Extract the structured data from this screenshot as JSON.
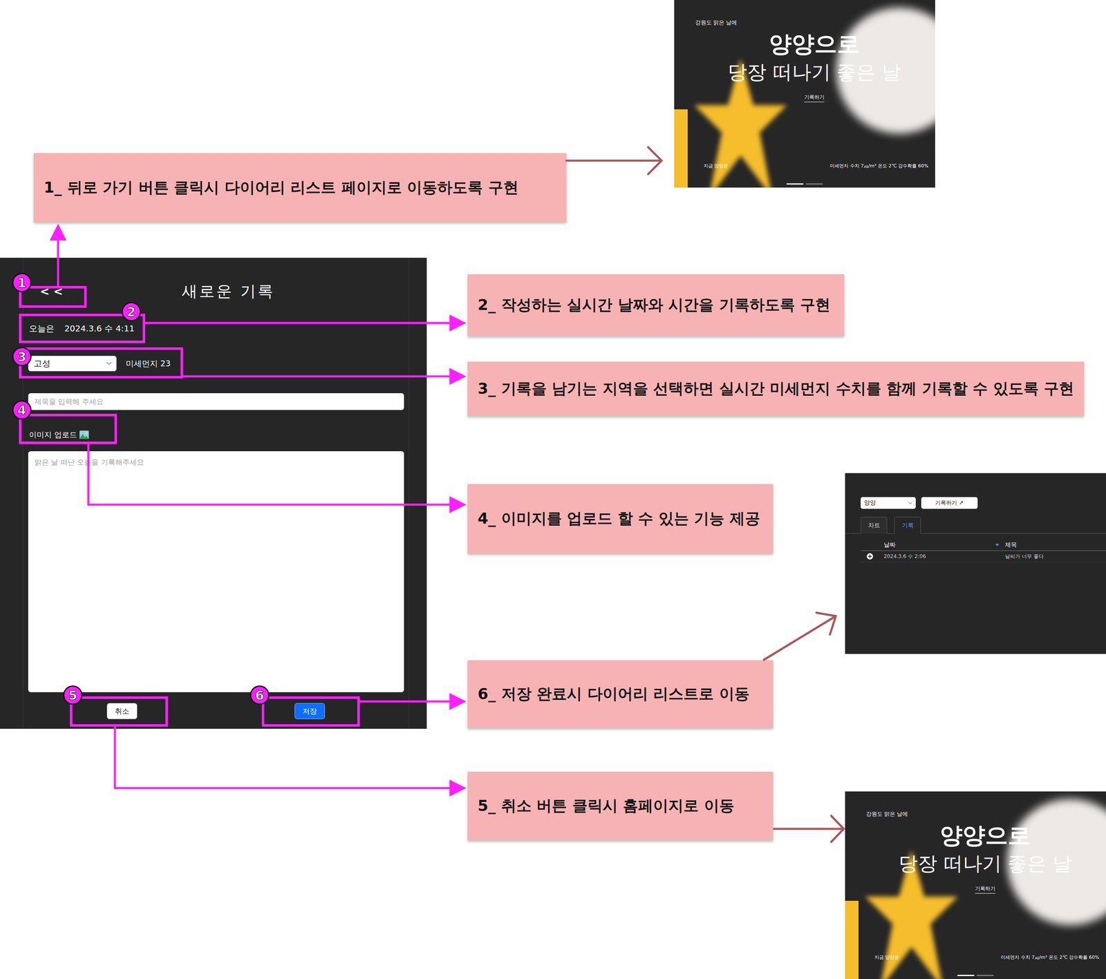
{
  "form": {
    "back": "< <",
    "title": "새로운 기록",
    "date_label": "오늘은",
    "date_value": "2024.3.6 수 4:11",
    "region": "고성",
    "dust": "미세먼지 23",
    "title_placeholder": "제목을 입력해 주세요",
    "upload": "이미지 업로드",
    "body_placeholder": "맑은 날 떠난 오늘을 기록해주세요",
    "cancel": "취소",
    "save": "저장"
  },
  "annotations": [
    {
      "number": "1",
      "text": "1_ 뒤로 가기 버튼 클릭시 다이어리 리스트 페이지로 이동하도록 구현"
    },
    {
      "number": "2",
      "text": "2_ 작성하는 실시간 날짜와 시간을 기록하도록 구현"
    },
    {
      "number": "3",
      "text": "3_ 기록을 남기는 지역을 선택하면 실시간 미세먼지 수치를 함께 기록할 수 있도록 구현"
    },
    {
      "number": "4",
      "text": "4_ 이미지를 업로드 할 수 있는 기능 제공"
    },
    {
      "number": "5",
      "text": "5_ 취소 버튼 클릭시 홈페이지로 이동"
    },
    {
      "number": "6",
      "text": "6_ 저장 완료시 다이어리 리스트로 이동"
    }
  ],
  "home_screens": [
    {
      "caption": "강원도 맑은 날에",
      "headline": "양양으로",
      "subline": "당장 떠나기 좋은 날",
      "action": "기록하기",
      "place": "지금 양양은",
      "weather": "미세먼지 수치 7㎍/m³ 온도 2℃ 강수확률 60%",
      "pages": [
        {
          "selected": true
        },
        {
          "selected": false
        }
      ]
    },
    {
      "caption": "강원도 맑은 날에",
      "headline": "양양으로",
      "subline": "당장 떠나기 좋은 날",
      "action": "기록하기",
      "place": "지금 양양은",
      "weather": "미세먼지 수치 7㎍/m³ 온도 2℃ 강수확률 60%",
      "pages": [
        {
          "selected": true
        },
        {
          "selected": false
        }
      ]
    }
  ],
  "list_screen": {
    "region": "양양",
    "record_button": "기록하기 ↗",
    "tabs": [
      {
        "label": "차트",
        "selected": false
      },
      {
        "label": "기록",
        "selected": true
      }
    ],
    "columns": [
      "날짜",
      "제목"
    ],
    "rows": [
      {
        "date": "2024.3.6 수 2:06",
        "title": "날씨가 너무 좋다"
      }
    ]
  }
}
